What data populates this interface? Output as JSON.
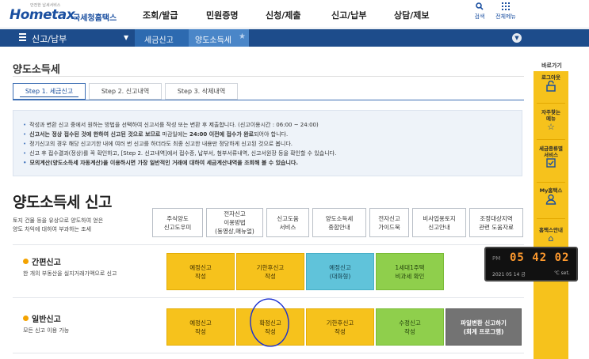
{
  "header": {
    "logo_small": "안전한 납세서비스",
    "logo_brand": "Hometax",
    "logo_name": "국세청홈택스",
    "menu": [
      "조회/발급",
      "민원증명",
      "신청/제출",
      "신고/납부",
      "상담/제보"
    ],
    "search_label": "검색",
    "all_menu_label": "전체메뉴"
  },
  "nav": {
    "category": "신고/납부",
    "crumb1": "세금신고",
    "crumb2": "양도소득세"
  },
  "page": {
    "title": "양도소득세",
    "tabs": [
      "Step 1. 세금신고",
      "Step 2. 신고내역",
      "Step 3. 삭제내역"
    ]
  },
  "notice": {
    "line1": "작성과 변환 신고 중에서 원하는 방법을 선택하여 신고서를 작성 또는 변환 후 제출합니다. (신고이용시간 : 06:00 ~ 24:00)",
    "line2a": "신고서는 정상 접수된 것에 한하여 신고된 것으로 보므로",
    "line2b": " 마감일에는 ",
    "line2c": "24:00 이전에 접수가 완료",
    "line2d": "되어야 합니다.",
    "line3": "정기신고의 경우 해당 신고기한 내에 여러 번 신고를 하더라도 최종 신고한 내용만 정당하게 신고된 것으로 봅니다.",
    "line4": "신고 후 접수결과(정상)를 꼭 확인하고, [Step 2. 신고내역]에서 접수증, 납부서, 첨부서류내역, 신고서원장 등을 확인할 수 있습니다.",
    "line5": "모의계산(양도소득세 자동계산)을 이용하시면 가장 일반적인 거래에 대하여 세금계산내역을 조회해 볼 수 있습니다."
  },
  "main": {
    "title": "양도소득세 신고",
    "desc1": "토지 건물 등을 유상으로 양도하여 얻은",
    "desc2": "양도 차익에 대하여 부과하는 조세",
    "service_buttons": [
      "주식양도\n신고도우미",
      "전자신고\n이용방법\n(동영상,매뉴얼)",
      "신고도움\n서비스",
      "양도소득세\n종합안내",
      "전자신고\n가이드북",
      "비사업용토지\n신고안내",
      "조정대상지역\n관련 도움자료"
    ]
  },
  "simple": {
    "title": "간편신고",
    "desc": "한 개의 부동산을 실지거래가액으로 신고",
    "buttons": [
      "예정신고\n작성",
      "기한후신고\n작성",
      "예정신고\n(대화형)",
      "1세대1주택\n비과세 확인"
    ]
  },
  "general": {
    "title": "일반신고",
    "desc": "모든 신고 이용 가능",
    "buttons": [
      "예정신고\n작성",
      "확정신고\n작성",
      "기한후신고\n작성",
      "수정신고\n작성",
      "파일변환 신고하기\n(회계 프로그램)"
    ]
  },
  "quick": {
    "label": "바로가기",
    "items": [
      "로그아웃",
      "자주찾는\n메뉴",
      "세금종류별\n서비스",
      "My홈택스",
      "홈택스안내"
    ]
  },
  "clock": {
    "ampm": "PM",
    "time": "05 42 02",
    "date": "2021 05 14  금",
    "temp": "℃ set."
  }
}
